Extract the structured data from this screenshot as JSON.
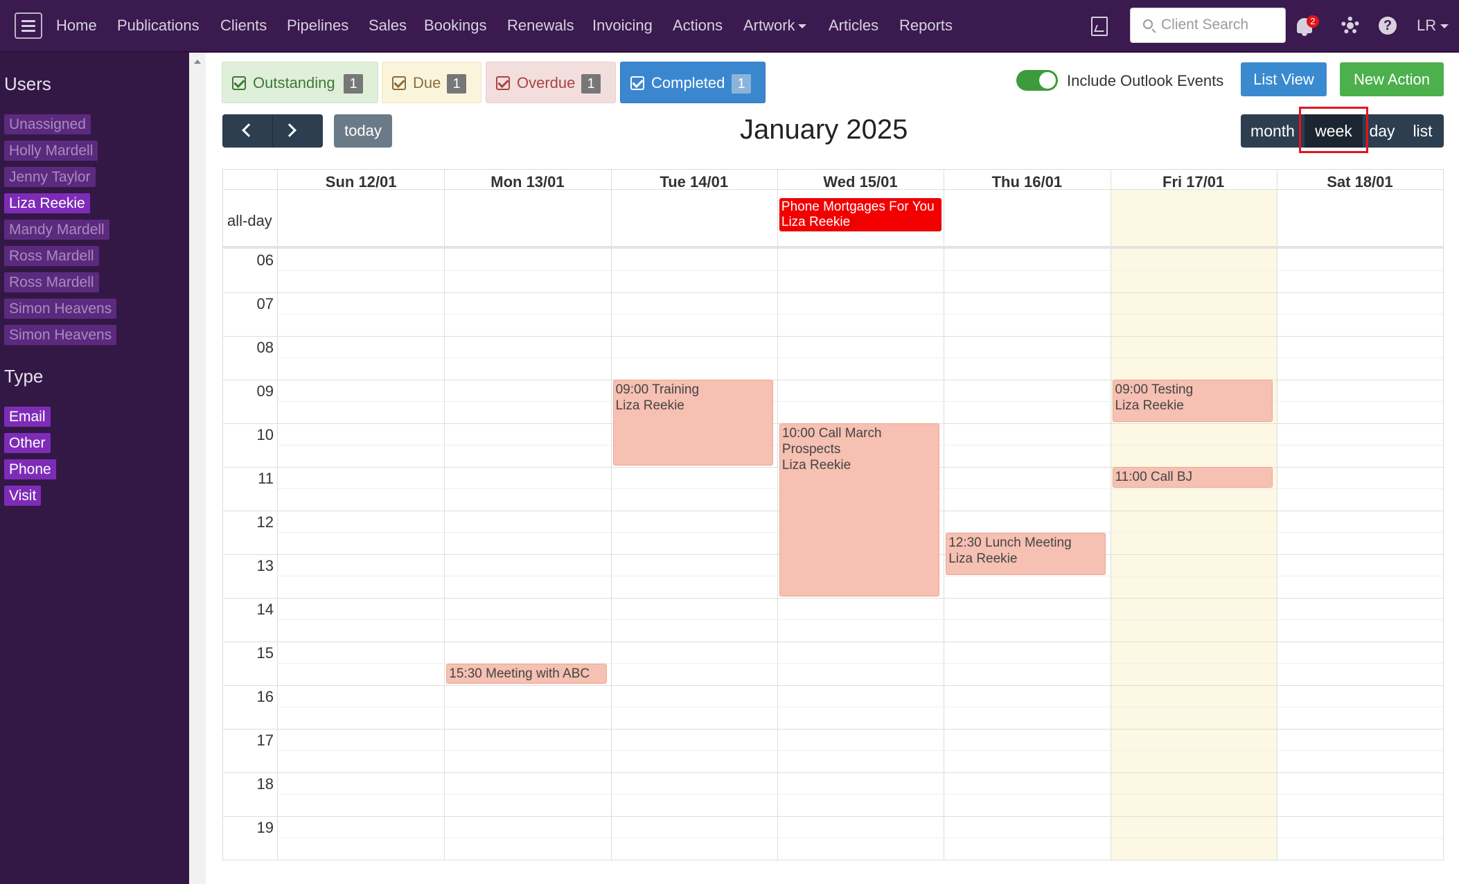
{
  "navbar": {
    "items": [
      {
        "label": "Home"
      },
      {
        "label": "Publications"
      },
      {
        "label": "Clients"
      },
      {
        "label": "Pipelines"
      },
      {
        "label": "Sales"
      },
      {
        "label": "Bookings"
      },
      {
        "label": "Renewals"
      },
      {
        "label": "Invoicing"
      },
      {
        "label": "Actions"
      },
      {
        "label": "Artwork"
      },
      {
        "label": "Articles"
      },
      {
        "label": "Reports"
      }
    ],
    "search_placeholder": "Client Search",
    "notification_count": "2",
    "user_initials": "LR",
    "icons": [
      "hamburger-icon",
      "document-image-icon",
      "search-icon",
      "bell-icon",
      "gear-icon",
      "help-icon"
    ]
  },
  "sidebar": {
    "users_heading": "Users",
    "users": [
      {
        "label": "Unassigned",
        "active": false
      },
      {
        "label": "Holly Mardell",
        "active": false
      },
      {
        "label": "Jenny Taylor",
        "active": false
      },
      {
        "label": "Liza Reekie",
        "active": true
      },
      {
        "label": "Mandy Mardell",
        "active": false
      },
      {
        "label": "Ross Mardell",
        "active": false
      },
      {
        "label": "Ross Mardell",
        "active": false
      },
      {
        "label": "Simon Heavens",
        "active": false
      },
      {
        "label": "Simon Heavens",
        "active": false
      }
    ],
    "type_heading": "Type",
    "types": [
      {
        "label": "Email"
      },
      {
        "label": "Other"
      },
      {
        "label": "Phone"
      },
      {
        "label": "Visit"
      }
    ]
  },
  "filters": {
    "outstanding": {
      "label": "Outstanding",
      "count": "1"
    },
    "due": {
      "label": "Due",
      "count": "1"
    },
    "overdue": {
      "label": "Overdue",
      "count": "1"
    },
    "completed": {
      "label": "Completed",
      "count": "1"
    }
  },
  "controls": {
    "outlook_label": "Include Outlook Events",
    "outlook_enabled": true,
    "list_view_label": "List View",
    "new_action_label": "New Action"
  },
  "calendar": {
    "title": "January 2025",
    "today_label": "today",
    "views": {
      "month": "month",
      "week": "week",
      "day": "day",
      "list": "list"
    },
    "active_view": "week",
    "allday_label": "all-day",
    "days": [
      "Sun 12/01",
      "Mon 13/01",
      "Tue 14/01",
      "Wed 15/01",
      "Thu 16/01",
      "Fri 17/01",
      "Sat 18/01"
    ],
    "today_index": 5,
    "hours": [
      "06",
      "07",
      "08",
      "09",
      "10",
      "11",
      "12",
      "13",
      "14",
      "15",
      "16",
      "17",
      "18",
      "19"
    ],
    "allday_events": [
      {
        "title": "Phone Mortgages For You",
        "user": "Liza Reekie",
        "day": 3
      }
    ],
    "events": [
      {
        "time": "09:00",
        "title": "Training",
        "user": "Liza Reekie",
        "day": 2,
        "start": 9.0,
        "end": 11.0
      },
      {
        "time": "10:00",
        "title": "Call March Prospects",
        "user": "Liza Reekie",
        "day": 3,
        "start": 10.0,
        "end": 14.0
      },
      {
        "time": "12:30",
        "title": "Lunch Meeting",
        "user": "Liza Reekie",
        "day": 4,
        "start": 12.5,
        "end": 13.5
      },
      {
        "time": "09:00",
        "title": "Testing",
        "user": "Liza Reekie",
        "day": 5,
        "start": 9.0,
        "end": 10.0
      },
      {
        "time": "11:00",
        "title": "Call BJ",
        "user": "",
        "day": 5,
        "start": 11.0,
        "end": 11.5
      },
      {
        "time": "15:30",
        "title": "Meeting with ABC",
        "user": "",
        "day": 1,
        "start": 15.5,
        "end": 16.0
      }
    ]
  },
  "colors": {
    "navbar": "#3a1a4f",
    "sidebar": "#331846",
    "event": "#f6c0b2",
    "allday_event": "#f20000",
    "today_column": "#fcf8e3"
  }
}
